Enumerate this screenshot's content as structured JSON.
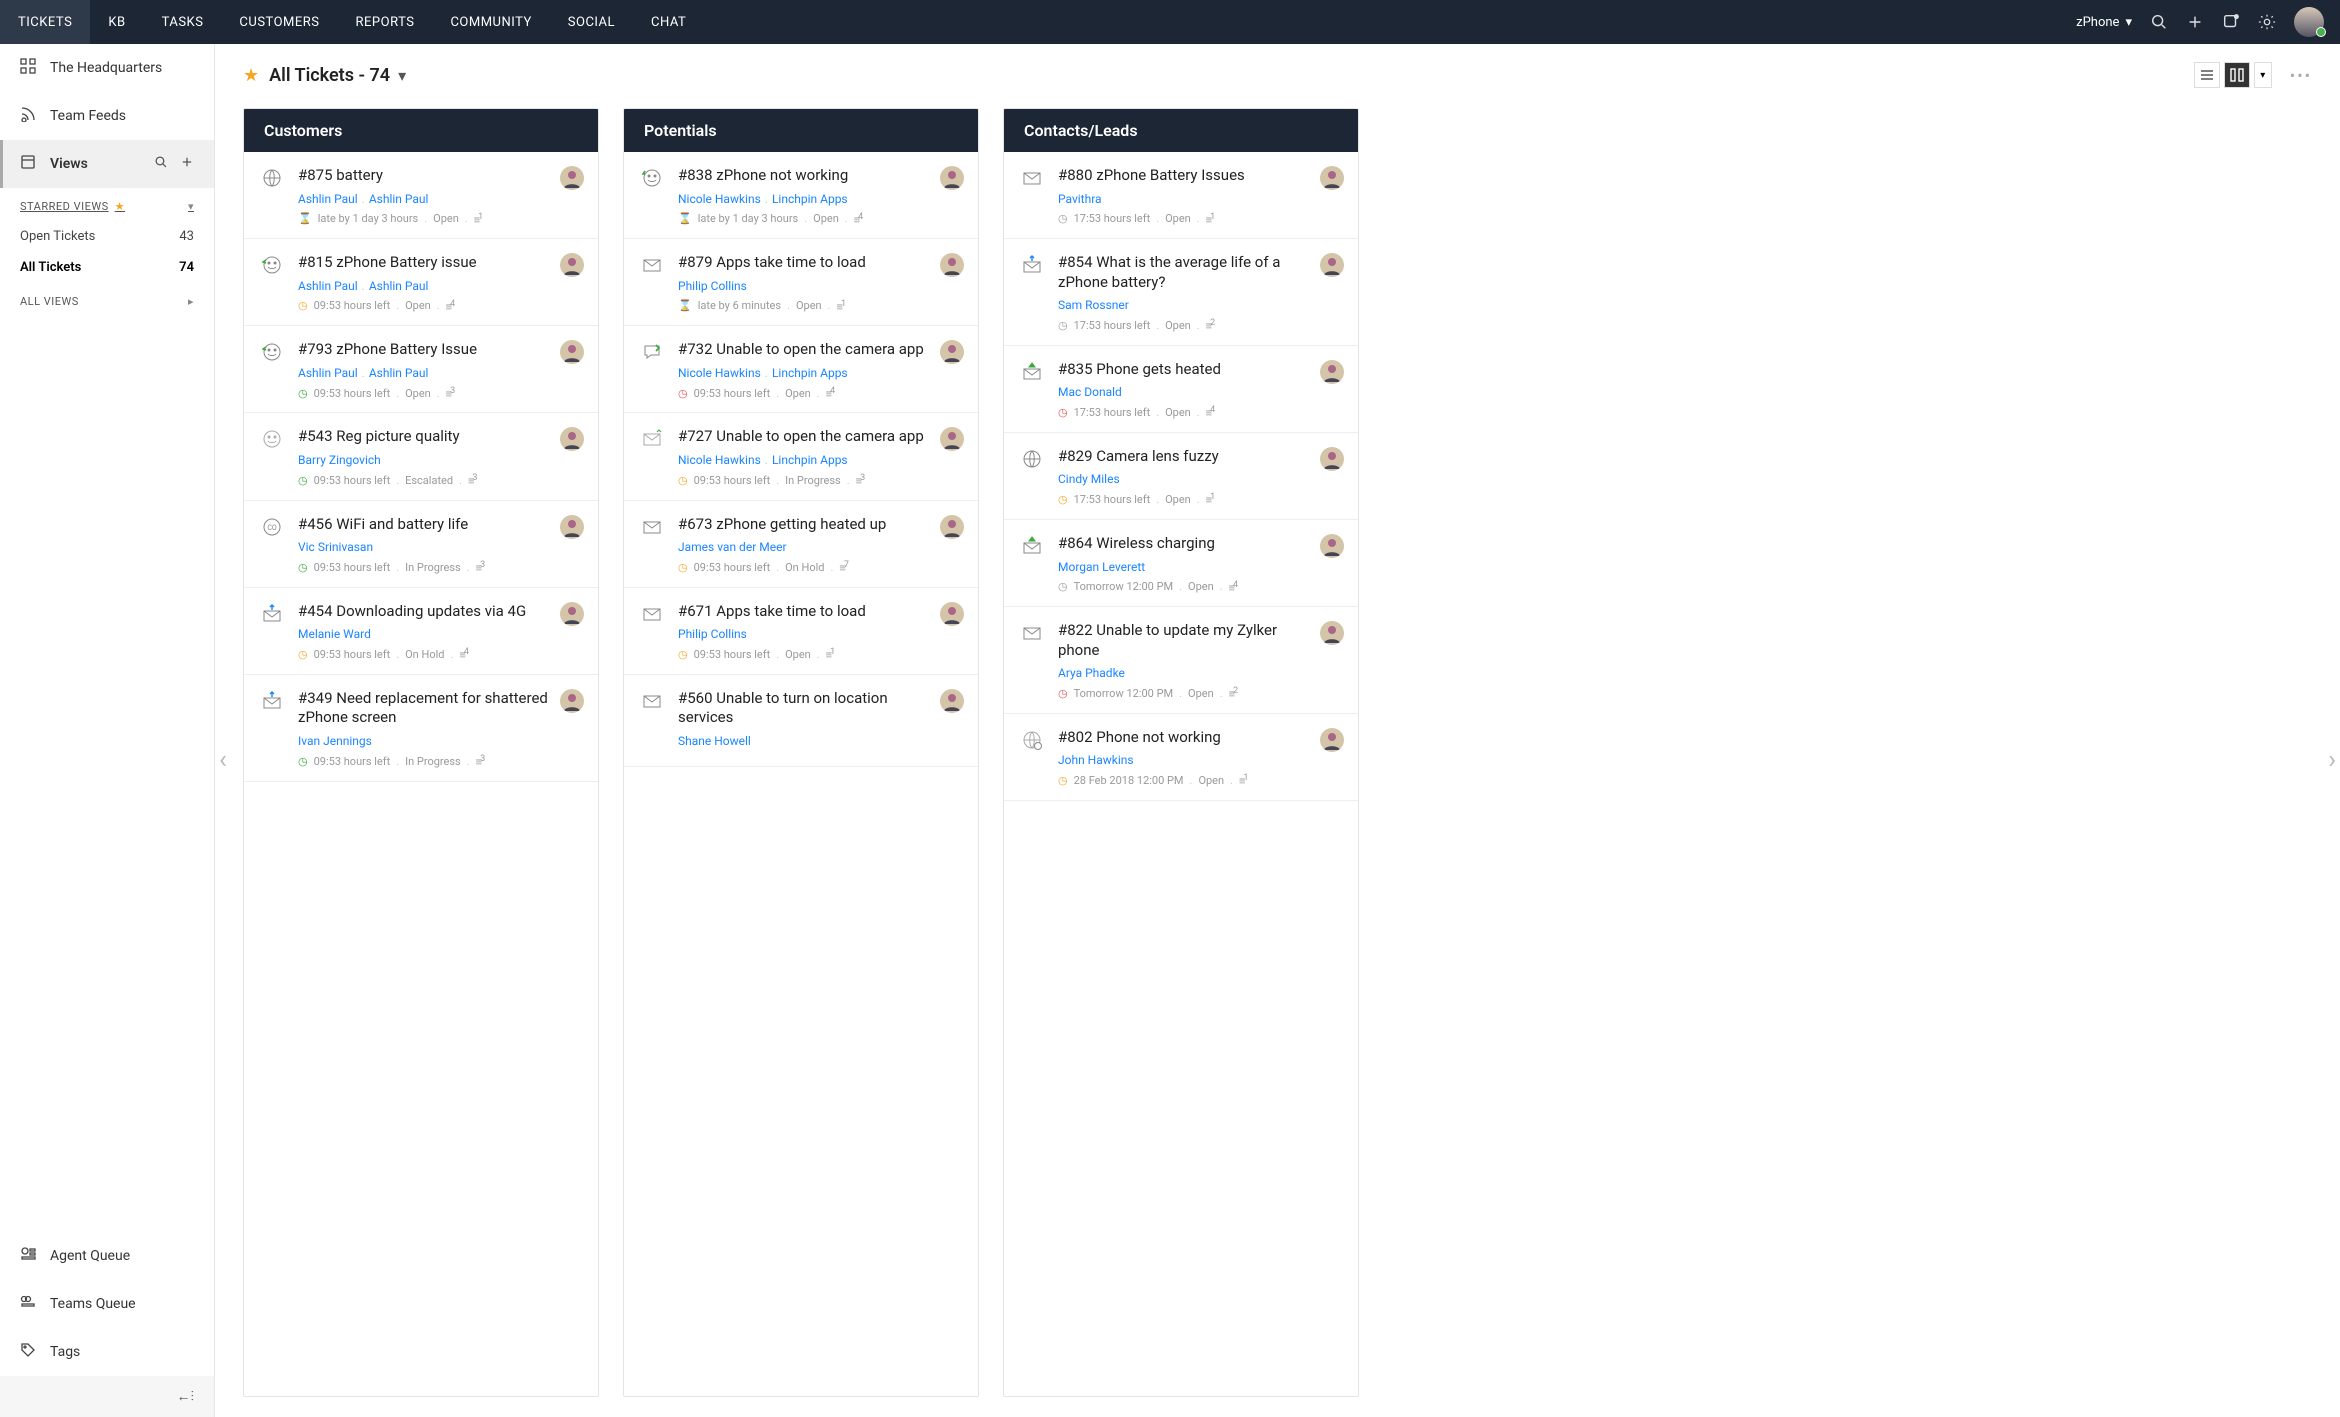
{
  "nav": {
    "tabs": [
      "TICKETS",
      "KB",
      "TASKS",
      "CUSTOMERS",
      "REPORTS",
      "COMMUNITY",
      "SOCIAL",
      "CHAT"
    ],
    "active": 0,
    "brand": "zPhone"
  },
  "sidebar": {
    "hq": "The Headquarters",
    "feeds": "Team Feeds",
    "views": "Views",
    "starred_label": "STARRED VIEWS",
    "filters": [
      {
        "label": "Open Tickets",
        "count": "43",
        "active": false
      },
      {
        "label": "All Tickets",
        "count": "74",
        "active": true
      }
    ],
    "all_views_label": "ALL VIEWS",
    "agent_queue": "Agent Queue",
    "teams_queue": "Teams Queue",
    "tags": "Tags"
  },
  "header": {
    "title": "All Tickets - 74"
  },
  "columns": [
    {
      "title": "Customers",
      "cards": [
        {
          "icon": "globe",
          "title": "#875 battery",
          "links": [
            "Ashlin Paul",
            "Ashlin Paul"
          ],
          "time_icon": "late",
          "time": "late by 1 day 3 hours",
          "status": "Open",
          "thread": "1",
          "avatar": "m1"
        },
        {
          "icon": "smile-green",
          "title": "#815 zPhone Battery issue",
          "links": [
            "Ashlin Paul",
            "Ashlin Paul"
          ],
          "time_icon": "clock-orange",
          "time": "09:53 hours left",
          "status": "Open",
          "thread": "4",
          "avatar": "m1"
        },
        {
          "icon": "smile-green",
          "title": "#793 zPhone Battery Issue",
          "links": [
            "Ashlin Paul",
            "Ashlin Paul"
          ],
          "time_icon": "clock-green",
          "time": "09:53 hours left",
          "status": "Open",
          "thread": "3",
          "avatar": "m1"
        },
        {
          "icon": "smile-grey",
          "title": "#543 Reg picture quality",
          "links": [
            "Barry Zingovich"
          ],
          "time_icon": "clock-green",
          "time": "09:53 hours left",
          "status": "Escalated",
          "thread": "3",
          "avatar": "m2"
        },
        {
          "icon": "co",
          "title": "#456 WiFi and battery life",
          "links": [
            "Vic Srinivasan"
          ],
          "time_icon": "clock-green",
          "time": "09:53 hours left",
          "status": "In Progress",
          "thread": "3",
          "avatar": "m3"
        },
        {
          "icon": "mail-up",
          "title": "#454 Downloading updates via 4G",
          "links": [
            "Melanie Ward"
          ],
          "time_icon": "clock-orange",
          "time": "09:53 hours left",
          "status": "On Hold",
          "thread": "4",
          "avatar": "f1"
        },
        {
          "icon": "mail-up",
          "title": "#349 Need replacement for shattered zPhone screen",
          "links": [
            "Ivan Jennings"
          ],
          "time_icon": "clock-green",
          "time": "09:53 hours left",
          "status": "In Progress",
          "thread": "3",
          "avatar": "m4"
        }
      ]
    },
    {
      "title": "Potentials",
      "cards": [
        {
          "icon": "smile-arrow",
          "title": "#838 zPhone not working",
          "links": [
            "Nicole Hawkins",
            "Linchpin Apps"
          ],
          "time_icon": "late",
          "time": "late by 1 day 3 hours",
          "status": "Open",
          "thread": "4",
          "avatar": "f2"
        },
        {
          "icon": "mail",
          "title": "#879 Apps take time to load",
          "links": [
            "Philip Collins"
          ],
          "time_icon": "late",
          "time": "late by 6 minutes",
          "status": "Open",
          "thread": "1",
          "avatar": "m5"
        },
        {
          "icon": "chat-green",
          "title": "#732 Unable to open the camera app",
          "links": [
            "Nicole Hawkins",
            "Linchpin Apps"
          ],
          "time_icon": "clock-red",
          "time": "09:53 hours left",
          "status": "Open",
          "thread": "4",
          "avatar": "m6"
        },
        {
          "icon": "mail-grey",
          "title": "#727 Unable to open the camera app",
          "links": [
            "Nicole Hawkins",
            "Linchpin Apps"
          ],
          "time_icon": "clock-orange",
          "time": "09:53 hours left",
          "status": "In Progress",
          "thread": "3",
          "avatar": "m7"
        },
        {
          "icon": "mail",
          "title": "#673 zPhone getting heated up",
          "links": [
            "James van der Meer"
          ],
          "time_icon": "clock-orange",
          "time": "09:53 hours left",
          "status": "On Hold",
          "thread": "7",
          "avatar": "m8"
        },
        {
          "icon": "mail",
          "title": "#671 Apps take time to load",
          "links": [
            "Philip Collins"
          ],
          "time_icon": "clock-orange",
          "time": "09:53 hours left",
          "status": "Open",
          "thread": "1",
          "avatar": "m9"
        },
        {
          "icon": "mail",
          "title": "#560 Unable to turn on location services",
          "links": [
            "Shane Howell"
          ],
          "time_icon": "",
          "time": "",
          "status": "",
          "thread": "",
          "avatar": "m10"
        }
      ]
    },
    {
      "title": "Contacts/Leads",
      "cards": [
        {
          "icon": "mail",
          "title": "#880 zPhone Battery Issues",
          "links": [
            "Pavithra"
          ],
          "time_icon": "clock-grey",
          "time": "17:53 hours left",
          "status": "Open",
          "thread": "1",
          "avatar": "m11"
        },
        {
          "icon": "mail-up",
          "title": "#854 What is the average life of a zPhone battery?",
          "links": [
            "Sam Rossner"
          ],
          "time_icon": "clock-grey",
          "time": "17:53 hours left",
          "status": "Open",
          "thread": "2",
          "avatar": "m12"
        },
        {
          "icon": "mail-green",
          "title": "#835 Phone gets heated",
          "links": [
            "Mac Donald"
          ],
          "time_icon": "clock-red",
          "time": "17:53 hours left",
          "status": "Open",
          "thread": "4",
          "avatar": "m13"
        },
        {
          "icon": "globe",
          "title": "#829 Camera lens fuzzy",
          "links": [
            "Cindy Miles"
          ],
          "time_icon": "clock-orange",
          "time": "17:53 hours left",
          "status": "Open",
          "thread": "1",
          "avatar": "f3"
        },
        {
          "icon": "mail-green",
          "title": "#864 Wireless charging",
          "links": [
            "Morgan Leverett"
          ],
          "time_icon": "clock-grey",
          "time": "Tomorrow 12:00 PM",
          "status": "Open",
          "thread": "4",
          "avatar": "m14"
        },
        {
          "icon": "mail",
          "title": "#822 Unable to update my Zylker phone",
          "links": [
            "Arya Phadke"
          ],
          "time_icon": "clock-red",
          "time": "Tomorrow 12:00 PM",
          "status": "Open",
          "thread": "2",
          "avatar": "m15"
        },
        {
          "icon": "globe-grey",
          "title": "#802 Phone not working",
          "links": [
            "John Hawkins"
          ],
          "time_icon": "clock-orange",
          "time": "28 Feb 2018 12:00 PM",
          "status": "Open",
          "thread": "1",
          "avatar": "m16"
        }
      ]
    }
  ]
}
